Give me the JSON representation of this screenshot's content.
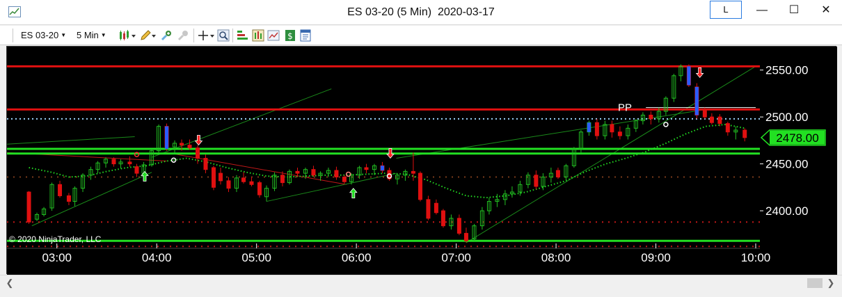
{
  "window": {
    "title": "ES 03-20 (5 Min)  2020-03-17",
    "link_button": "L",
    "minimize": "—",
    "maximize": "☐",
    "close": "✕"
  },
  "toolbar": {
    "instrument": "ES 03-20",
    "interval": "5 Min",
    "icons": [
      "bars-style-icon",
      "draw-pencil-icon",
      "zoom-in-icon",
      "zoom-out-icon",
      "crosshair-icon",
      "magnifier-icon",
      "indicators-icon",
      "strategies-icon",
      "chart-style-icon",
      "dollar-icon",
      "properties-icon"
    ]
  },
  "chart": {
    "copyright": "© 2020 NinjaTrader, LLC",
    "current_price_label": "2478.00",
    "pp_label": "PP",
    "colors": {
      "background": "#000000",
      "up": "#22c022",
      "down": "#e01010",
      "hline_red": "#e01010",
      "hline_green": "#22e022",
      "price_tag": "#22e022",
      "ma": "#22dd22",
      "zero_dots": "#00b050"
    }
  },
  "chart_data": {
    "type": "candlestick",
    "x_tick_labels": [
      "03:00",
      "04:00",
      "05:00",
      "06:00",
      "07:00",
      "08:00",
      "09:00",
      "10:00"
    ],
    "y_tick_labels": [
      "2400.00",
      "2450.00",
      "2500.00",
      "2550.00"
    ],
    "y_ticks": [
      2400,
      2450,
      2500,
      2550
    ],
    "ylim": [
      2360,
      2575
    ],
    "time_range_hours": [
      2.5,
      10
    ],
    "horizontal_levels": [
      {
        "price": 2554,
        "color": "red"
      },
      {
        "price": 2508,
        "color": "red"
      },
      {
        "price": 2466,
        "color": "green"
      },
      {
        "price": 2461,
        "color": "green"
      },
      {
        "price": 2368,
        "color": "green"
      }
    ],
    "dotted_levels": [
      {
        "price": 2498,
        "color": "cyan"
      },
      {
        "price": 2436,
        "color": "brown"
      },
      {
        "price": 2388,
        "color": "red"
      },
      {
        "price": 2362,
        "color": "red"
      }
    ],
    "candles": [
      [
        2.72,
        2420,
        2421,
        2386,
        2388
      ],
      [
        2.8,
        2391,
        2398,
        2389,
        2396
      ],
      [
        2.87,
        2396,
        2404,
        2394,
        2402
      ],
      [
        2.95,
        2403,
        2430,
        2400,
        2428
      ],
      [
        3.03,
        2428,
        2432,
        2414,
        2416
      ],
      [
        3.12,
        2416,
        2419,
        2406,
        2410
      ],
      [
        3.18,
        2410,
        2426,
        2405,
        2424
      ],
      [
        3.26,
        2424,
        2440,
        2420,
        2438
      ],
      [
        3.34,
        2438,
        2447,
        2433,
        2444
      ],
      [
        3.41,
        2444,
        2453,
        2440,
        2451
      ],
      [
        3.49,
        2451,
        2457,
        2446,
        2455
      ],
      [
        3.57,
        2455,
        2457,
        2447,
        2450
      ],
      [
        3.64,
        2450,
        2455,
        2445,
        2452
      ],
      [
        3.73,
        2452,
        2458,
        2447,
        2450
      ],
      [
        3.8,
        2447,
        2450,
        2436,
        2440
      ],
      [
        3.87,
        2440,
        2452,
        2438,
        2449
      ],
      [
        3.95,
        2449,
        2466,
        2447,
        2464
      ],
      [
        4.02,
        2464,
        2492,
        2462,
        2490
      ],
      [
        4.1,
        2490,
        2493,
        2464,
        2468
      ],
      [
        4.18,
        2468,
        2475,
        2462,
        2472
      ],
      [
        4.25,
        2472,
        2476,
        2464,
        2470
      ],
      [
        4.33,
        2470,
        2476,
        2465,
        2467
      ],
      [
        4.41,
        2467,
        2470,
        2450,
        2456
      ],
      [
        4.49,
        2456,
        2460,
        2440,
        2444
      ],
      [
        4.57,
        2446,
        2448,
        2422,
        2425
      ],
      [
        4.64,
        2440,
        2446,
        2428,
        2432
      ],
      [
        4.72,
        2432,
        2436,
        2420,
        2424
      ],
      [
        4.8,
        2424,
        2438,
        2420,
        2435
      ],
      [
        4.87,
        2435,
        2441,
        2429,
        2431
      ],
      [
        4.95,
        2431,
        2436,
        2426,
        2428
      ],
      [
        5.03,
        2430,
        2432,
        2414,
        2417
      ],
      [
        5.1,
        2415,
        2427,
        2410,
        2424
      ],
      [
        5.18,
        2424,
        2441,
        2421,
        2438
      ],
      [
        5.26,
        2438,
        2442,
        2426,
        2430
      ],
      [
        5.33,
        2430,
        2444,
        2428,
        2442
      ],
      [
        5.41,
        2442,
        2446,
        2436,
        2440
      ],
      [
        5.49,
        2440,
        2446,
        2434,
        2444
      ],
      [
        5.57,
        2444,
        2448,
        2436,
        2438
      ],
      [
        5.64,
        2438,
        2442,
        2432,
        2440
      ],
      [
        5.72,
        2440,
        2446,
        2436,
        2443
      ],
      [
        5.8,
        2443,
        2447,
        2433,
        2436
      ],
      [
        5.88,
        2436,
        2438,
        2429,
        2431
      ],
      [
        5.95,
        2431,
        2440,
        2428,
        2438
      ],
      [
        6.03,
        2438,
        2448,
        2434,
        2446
      ],
      [
        6.1,
        2446,
        2450,
        2440,
        2444
      ],
      [
        6.18,
        2444,
        2450,
        2438,
        2448
      ],
      [
        6.26,
        2448,
        2452,
        2440,
        2443
      ],
      [
        6.33,
        2443,
        2446,
        2432,
        2434
      ],
      [
        6.41,
        2434,
        2440,
        2428,
        2438
      ],
      [
        6.49,
        2438,
        2444,
        2432,
        2442
      ],
      [
        6.57,
        2442,
        2462,
        2432,
        2440
      ],
      [
        6.64,
        2440,
        2442,
        2410,
        2412
      ],
      [
        6.72,
        2412,
        2416,
        2390,
        2392
      ],
      [
        6.8,
        2408,
        2412,
        2396,
        2398
      ],
      [
        6.87,
        2400,
        2402,
        2382,
        2384
      ],
      [
        6.95,
        2384,
        2396,
        2380,
        2392
      ],
      [
        7.03,
        2392,
        2396,
        2374,
        2376
      ],
      [
        7.1,
        2376,
        2382,
        2366,
        2368
      ],
      [
        7.18,
        2370,
        2386,
        2368,
        2384
      ],
      [
        7.26,
        2384,
        2404,
        2380,
        2400
      ],
      [
        7.33,
        2400,
        2414,
        2396,
        2410
      ],
      [
        7.41,
        2410,
        2418,
        2404,
        2412
      ],
      [
        7.49,
        2412,
        2422,
        2406,
        2418
      ],
      [
        7.56,
        2418,
        2426,
        2414,
        2420
      ],
      [
        7.64,
        2420,
        2432,
        2416,
        2428
      ],
      [
        7.72,
        2428,
        2441,
        2424,
        2438
      ],
      [
        7.8,
        2438,
        2443,
        2423,
        2426
      ],
      [
        7.87,
        2426,
        2440,
        2422,
        2436
      ],
      [
        7.95,
        2436,
        2446,
        2430,
        2440
      ],
      [
        8.02,
        2443,
        2446,
        2434,
        2436
      ],
      [
        8.1,
        2436,
        2450,
        2432,
        2448
      ],
      [
        8.18,
        2448,
        2468,
        2446,
        2466
      ],
      [
        8.25,
        2466,
        2486,
        2462,
        2484
      ],
      [
        8.33,
        2484,
        2496,
        2480,
        2494
      ],
      [
        8.41,
        2494,
        2498,
        2476,
        2480
      ],
      [
        8.49,
        2480,
        2496,
        2476,
        2492
      ],
      [
        8.56,
        2492,
        2496,
        2478,
        2484
      ],
      [
        8.64,
        2484,
        2490,
        2476,
        2480
      ],
      [
        8.72,
        2480,
        2492,
        2476,
        2488
      ],
      [
        8.8,
        2488,
        2498,
        2484,
        2496
      ],
      [
        8.87,
        2496,
        2505,
        2492,
        2502
      ],
      [
        8.95,
        2502,
        2506,
        2492,
        2498
      ],
      [
        9.03,
        2498,
        2510,
        2494,
        2506
      ],
      [
        9.1,
        2506,
        2522,
        2502,
        2520
      ],
      [
        9.18,
        2520,
        2546,
        2516,
        2544
      ],
      [
        9.25,
        2544,
        2556,
        2538,
        2554
      ],
      [
        9.33,
        2554,
        2556,
        2532,
        2534
      ],
      [
        9.41,
        2532,
        2536,
        2498,
        2502
      ],
      [
        9.49,
        2508,
        2510,
        2498,
        2500
      ],
      [
        9.56,
        2500,
        2504,
        2492,
        2494
      ],
      [
        9.64,
        2500,
        2503,
        2490,
        2493
      ],
      [
        9.72,
        2493,
        2495,
        2480,
        2484
      ],
      [
        9.8,
        2484,
        2490,
        2476,
        2486
      ],
      [
        9.89,
        2486,
        2488,
        2474,
        2478
      ]
    ],
    "moving_average": [
      [
        2.72,
        2446
      ],
      [
        2.95,
        2441
      ],
      [
        3.12,
        2436
      ],
      [
        3.3,
        2437
      ],
      [
        3.5,
        2442
      ],
      [
        3.7,
        2446
      ],
      [
        3.9,
        2448
      ],
      [
        4.1,
        2453
      ],
      [
        4.3,
        2456
      ],
      [
        4.5,
        2452
      ],
      [
        4.7,
        2446
      ],
      [
        4.9,
        2441
      ],
      [
        5.1,
        2437
      ],
      [
        5.3,
        2436
      ],
      [
        5.5,
        2437
      ],
      [
        5.7,
        2438
      ],
      [
        5.9,
        2438
      ],
      [
        6.1,
        2439
      ],
      [
        6.3,
        2440
      ],
      [
        6.5,
        2439
      ],
      [
        6.7,
        2433
      ],
      [
        6.9,
        2424
      ],
      [
        7.1,
        2416
      ],
      [
        7.3,
        2414
      ],
      [
        7.5,
        2416
      ],
      [
        7.7,
        2420
      ],
      [
        7.9,
        2426
      ],
      [
        8.1,
        2432
      ],
      [
        8.3,
        2442
      ],
      [
        8.5,
        2450
      ],
      [
        8.7,
        2456
      ],
      [
        8.9,
        2463
      ],
      [
        9.1,
        2472
      ],
      [
        9.3,
        2482
      ],
      [
        9.5,
        2490
      ],
      [
        9.7,
        2492
      ],
      [
        9.89,
        2488
      ]
    ]
  }
}
